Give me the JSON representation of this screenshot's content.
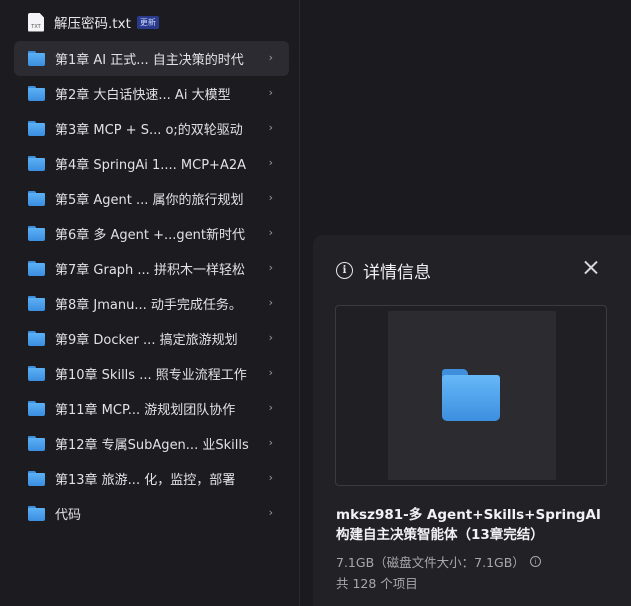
{
  "file": {
    "name": "解压密码.txt",
    "badge": "更新"
  },
  "folders": [
    {
      "label": "第1章 AI 正式... 自主决策的时代",
      "active": true
    },
    {
      "label": "第2章 大白话快速...   Ai 大模型",
      "active": false
    },
    {
      "label": "第3章 MCP + S...  o;的双轮驱动",
      "active": false
    },
    {
      "label": "第4章 SpringAi 1.... MCP+A2A",
      "active": false
    },
    {
      "label": "第5章 Agent ...  属你的旅行规划",
      "active": false
    },
    {
      "label": "第6章 多 Agent +...gent新时代",
      "active": false
    },
    {
      "label": "第7章 Graph ...  拼积木一样轻松",
      "active": false
    },
    {
      "label": "第8章 Jmanu...  动手完成任务。",
      "active": false
    },
    {
      "label": "第9章 Docker ...  搞定旅游规划",
      "active": false
    },
    {
      "label": "第10章 Skills ...  照专业流程工作",
      "active": false
    },
    {
      "label": "第11章 MCP...  游规划团队协作",
      "active": false
    },
    {
      "label": "第12章 专属SubAgen... 业Skills",
      "active": false
    },
    {
      "label": "第13章 旅游...   化，监控，部署",
      "active": false
    },
    {
      "label": "代码",
      "active": false
    }
  ],
  "detail": {
    "title": "详情信息",
    "folder_name": "mksz981-多 Agent+Skills+SpringAI 构建自主决策智能体（13章完结）",
    "size": "7.1GB（磁盘文件大小：7.1GB）",
    "count": "共 128 个项目"
  },
  "colors": {
    "accent_folder": "#4fa3ee",
    "background": "#1b1b1f",
    "panel": "#222226",
    "badge": "#2a3a8c"
  }
}
